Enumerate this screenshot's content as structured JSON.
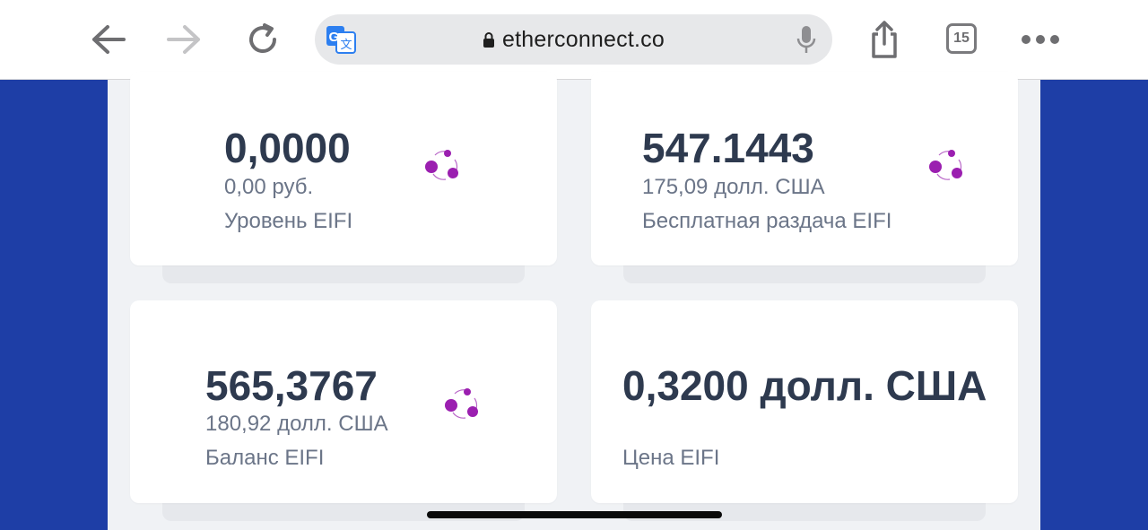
{
  "browser": {
    "url": "etherconnect.co",
    "tab_count": "15",
    "icons": [
      "back-icon",
      "forward-icon",
      "reload-icon",
      "translate-icon",
      "lock-icon",
      "mic-icon",
      "share-icon",
      "tabs-icon",
      "more-icon"
    ]
  },
  "cards": [
    {
      "value": "0,0000",
      "fiat": "0,00 руб.",
      "label": "Уровень EIFI"
    },
    {
      "value": "547.1443",
      "fiat": "175,09 долл. США",
      "label": "Бесплатная раздача EIFI"
    },
    {
      "value": "565,3767",
      "fiat": "180,92 долл. США",
      "label": "Баланс EIFI"
    },
    {
      "value": "0,3200 долл. США",
      "label": "Цена EIFI"
    }
  ],
  "colors": {
    "brand_blue": "#1e3ea6",
    "logo_purple": "#9b1fb0",
    "value_text": "#2e3a4f",
    "muted_text": "#6b7588"
  }
}
